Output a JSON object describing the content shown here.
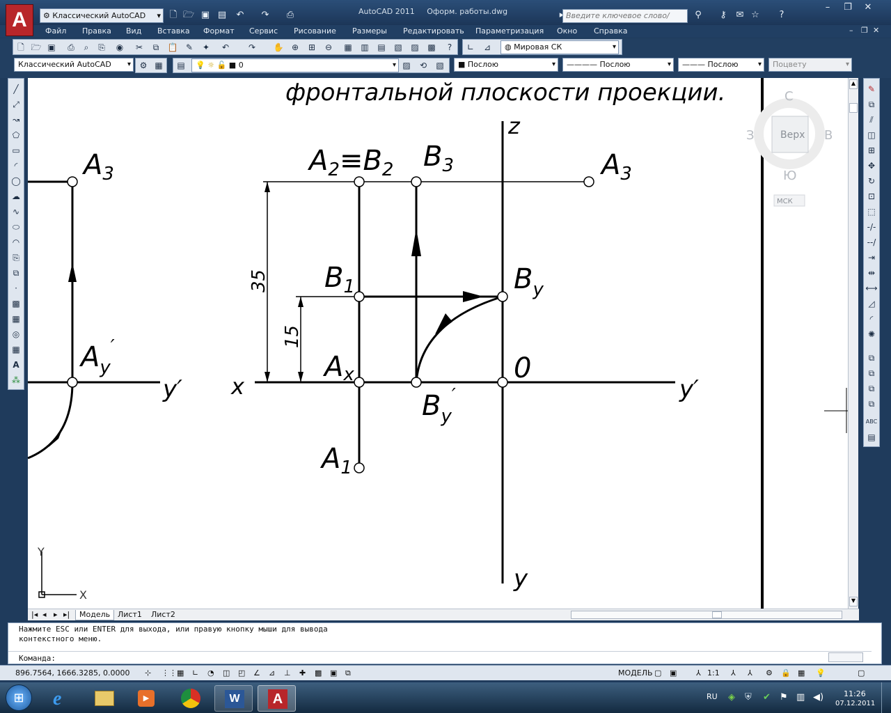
{
  "window": {
    "app_title": "AutoCAD 2011",
    "doc_title": "Оформ. работы.dwg",
    "workspace_quick": "Классический AutoCAD",
    "search_placeholder": "Введите ключевое слово/фразу"
  },
  "menu": [
    "Файл",
    "Правка",
    "Вид",
    "Вставка",
    "Формат",
    "Сервис",
    "Рисование",
    "Размеры",
    "Редактировать",
    "Параметризация",
    "Окно",
    "Справка"
  ],
  "toolbar": {
    "ucs": "Мировая СК",
    "workspace": "Классический AutoCAD",
    "layer": "0",
    "color": "Послою",
    "linetype": "Послою",
    "lineweight": "Послою",
    "plotstyle": "Поцвету"
  },
  "viewcube": {
    "top": "Верх",
    "north": "С",
    "south": "Ю",
    "west": "З",
    "east": "В",
    "ucs": "МСК"
  },
  "drawing": {
    "heading": "фронтальной плоскости проекции.",
    "labels": {
      "A3_left": "A",
      "A3_left_sub": "3",
      "A3_right": "A",
      "A3_right_sub": "3",
      "A2B2": "A",
      "A2B2_sub1": "2",
      "A2B2_eq": "≡B",
      "A2B2_sub2": "2",
      "B3": "B",
      "B3_sub": "3",
      "B1": "B",
      "B1_sub": "1",
      "By": "B",
      "By_sub": "y",
      "Ay_prime": "A",
      "Ay_prime_sub": "y",
      "Ay_prime_mark": "′",
      "Ax": "A",
      "Ax_sub": "x",
      "O": "0",
      "By_prime": "B",
      "By_prime_sub": "y",
      "By_prime_mark": "′",
      "A1": "A",
      "A1_sub": "1",
      "z": "z",
      "y_bottom": "y",
      "x": "x",
      "y_prime_left": "y′",
      "y_prime_right": "y′",
      "dim35": "35",
      "dim15": "15"
    },
    "ucs_icon": {
      "x": "X",
      "y": "Y"
    }
  },
  "layout_tabs": [
    "Модель",
    "Лист1",
    "Лист2"
  ],
  "command": {
    "line1": "Нажмите ESC или ENTER для выхода, или правую кнопку мыши для вывода",
    "line2": "контекстного меню.",
    "prompt": "Команда:"
  },
  "status": {
    "coords": "896.7564, 1666.3285, 0.0000",
    "model": "МОДЕЛЬ",
    "scale": "1:1"
  },
  "taskbar": {
    "lang": "RU",
    "time": "11:26",
    "date": "07.12.2011"
  },
  "colors": {
    "accent": "#b8262a",
    "chrome": "#223f61"
  }
}
